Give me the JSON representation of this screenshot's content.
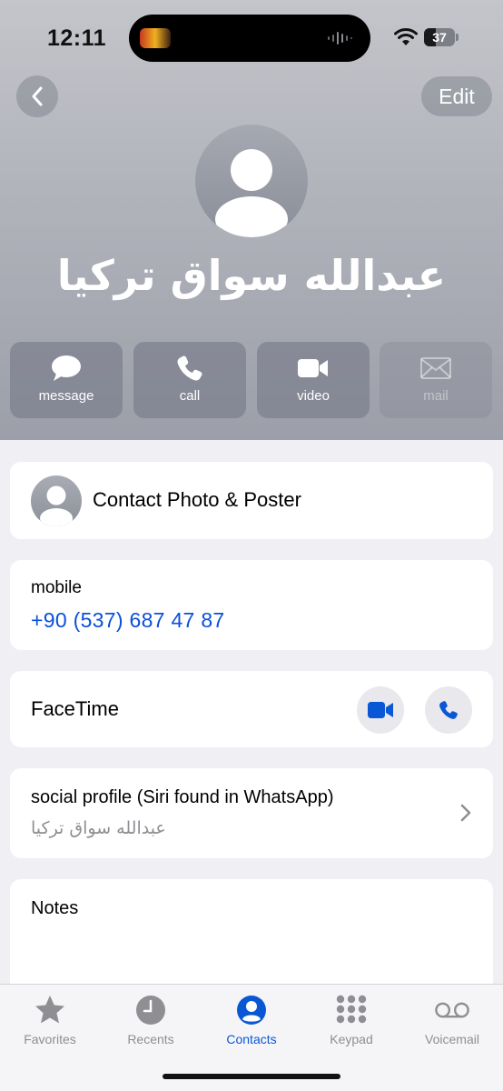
{
  "status_bar": {
    "time": "12:11",
    "battery": "37"
  },
  "nav": {
    "edit_label": "Edit"
  },
  "contact": {
    "name": "عبدالله سواق تركيا"
  },
  "actions": [
    {
      "label": "message",
      "icon": "message-bubble-icon",
      "enabled": true
    },
    {
      "label": "call",
      "icon": "phone-icon",
      "enabled": true
    },
    {
      "label": "video",
      "icon": "video-camera-icon",
      "enabled": true
    },
    {
      "label": "mail",
      "icon": "envelope-icon",
      "enabled": false
    }
  ],
  "poster": {
    "label": "Contact Photo & Poster"
  },
  "phone": {
    "label": "mobile",
    "value": "+90 (537) 687 47 87"
  },
  "facetime": {
    "label": "FaceTime"
  },
  "social": {
    "label": "social profile (Siri found in WhatsApp)",
    "value": "عبدالله سواق تركيا"
  },
  "notes": {
    "label": "Notes"
  },
  "tabs": [
    {
      "label": "Favorites",
      "icon": "star-icon",
      "active": false
    },
    {
      "label": "Recents",
      "icon": "clock-icon",
      "active": false
    },
    {
      "label": "Contacts",
      "icon": "person-circle-icon",
      "active": true
    },
    {
      "label": "Keypad",
      "icon": "keypad-icon",
      "active": false
    },
    {
      "label": "Voicemail",
      "icon": "voicemail-icon",
      "active": false
    }
  ],
  "colors": {
    "accent": "#0a57d6",
    "link": "#0a50d8",
    "inactive": "#8e8e93"
  }
}
